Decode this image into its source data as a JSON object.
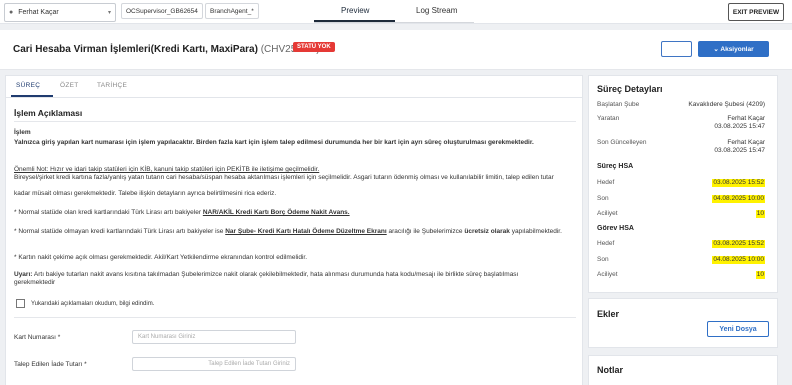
{
  "topbar": {
    "user": "Ferhat Kaçar",
    "chips": [
      "OCSupervisor_GB62654",
      "BranchAgent_*"
    ],
    "tabs": [
      "Preview",
      "Log Stream"
    ],
    "exit_label": "EXIT PREVIEW"
  },
  "header": {
    "title": "Cari Hesaba Virman İşlemleri(Kredi Kartı, MaxiPara)",
    "code": "(CHV25-436)",
    "status": "STATÜ YOK",
    "actions_label": "⌄ Aksiyonlar"
  },
  "subtabs": [
    "SÜREÇ",
    "ÖZET",
    "TARİHÇE"
  ],
  "content": {
    "section_title": "İşlem Açıklaması",
    "islem_label": "İşlem",
    "p1": "Yalnızca giriş yapılan kart numarası için işlem yapılacaktır. Birden fazla kart için işlem talep edilmesi durumunda her bir kart için ayrı süreç oluşturulması gerekmektedir.",
    "note_line": "Önemli Not: Hızır ve idari takip statüleri için KİB, kanuni takip statüleri için PEKİTB ile iletişime geçilmelidir.",
    "note_body_1": "Bireysel/şirket kredi kartına fazla/yanlış yatan tutarın cari hesaba/süspan hesaba aktarılması işlemleri için seçilmelidir. Asgari tutarın ödenmiş olması ve kullanılabilir limitin, talep edilen tutar",
    "note_body_2": "kadar müsait olması gerekmektedir. Talebe ilişkin detayların ayrıca belirtilmesini rica ederiz.",
    "bullet1_a": "* Normal statüde olan kredi kartlarındaki Türk Lirası artı bakiyeler ",
    "bullet1_b": "NAR/AKİL Kredi Kartı Borç Ödeme Nakit Avans.",
    "bullet2_a": "* Normal statüde olmayan kredi kartlarındaki Türk Lirası artı bakiyeler ise ",
    "bullet2_b": "Nar Şube- Kredi Kartı Hatalı Ödeme Düzeltme Ekranı",
    "bullet2_c": " aracılığı ile Şubelerimizce ",
    "bullet2_d": "ücretsiz olarak",
    "bullet2_e": " yapılabilmektedir.",
    "bullet3": "* Kartın nakit çekime açık olması gerekmektedir. Akil/Kart Yetkilendirme ekranından kontrol edilmelidir.",
    "warn_label": "Uyarı:",
    "warn_text": " Artı bakiye tutarları nakit avans kısıtına takılmadan Şubelerimizce nakit olarak çekilebilmektedir, hata alınması durumunda hata kodu/mesajı ile birlikte süreç başlatılması gerekmektedir",
    "checkbox_label": "Yukarıdaki açıklamaları okudum, bilgi edindim.",
    "card_label": "Kart Numarası *",
    "card_placeholder": "Kart Numarası Giriniz",
    "amount_label": "Talep Edilen İade Tutarı *",
    "amount_placeholder": "Talep Edilen İade Tutarı Giriniz"
  },
  "details": {
    "title": "Süreç Detayları",
    "rows": [
      {
        "label": "Başlatan Şube",
        "value": "Kavaklıdere Şubesi (4209)"
      },
      {
        "label": "Yaratan",
        "value": "Ferhat Kaçar",
        "value2": "03.08.2025 15:47"
      },
      {
        "label": "Son Güncelleyen",
        "value": "Ferhat Kaçar",
        "value2": "03.08.2025 15:47"
      }
    ],
    "surec_hsa": {
      "title": "Süreç HSA",
      "hedef_label": "Hedef",
      "hedef": "03.08.2025 15:52",
      "son_label": "Son",
      "son": "04.08.2025 10:00",
      "aciliyet_label": "Aciliyet",
      "aciliyet": "10"
    },
    "gorev_hsa": {
      "title": "Görev HSA",
      "hedef_label": "Hedef",
      "hedef": "03.08.2025 15:52",
      "son_label": "Son",
      "son": "04.08.2025 10:00",
      "aciliyet_label": "Aciliyet",
      "aciliyet": "10"
    }
  },
  "ekler": {
    "title": "Ekler",
    "button": "Yeni Dosya"
  },
  "notlar": {
    "title": "Notlar"
  },
  "colors": {
    "accent": "#2f6fc6",
    "status": "#e53935",
    "highlight": "#fff200"
  }
}
